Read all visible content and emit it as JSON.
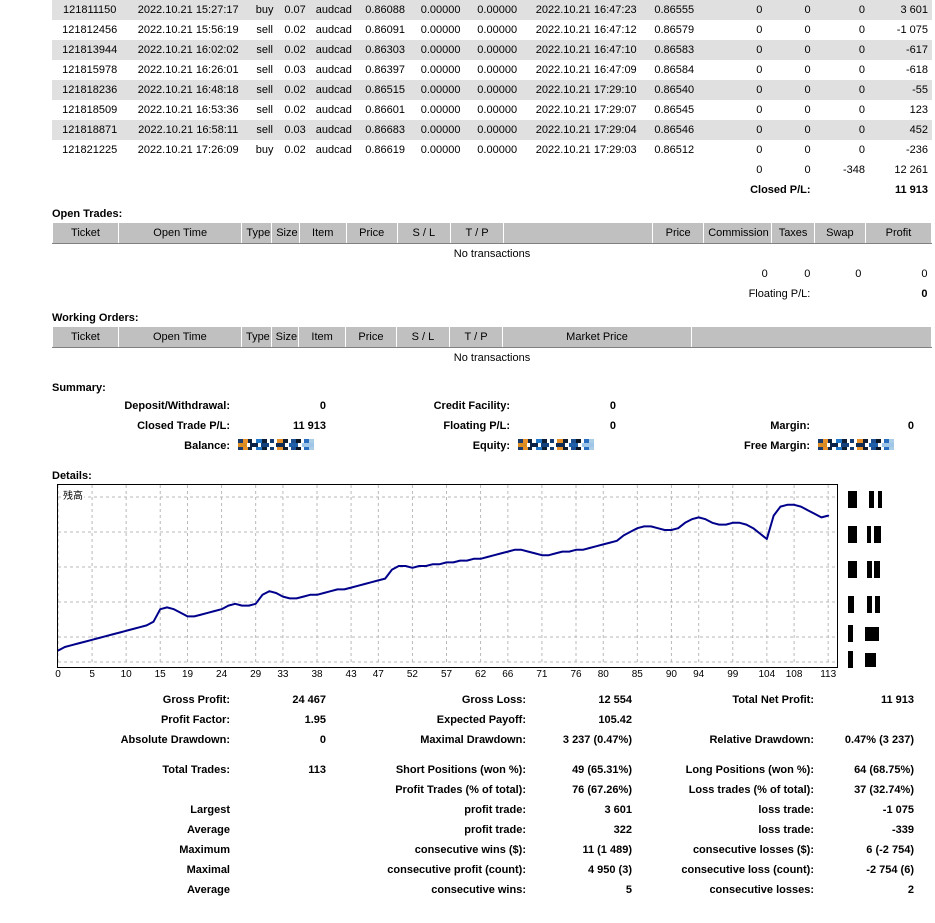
{
  "closed_deals": {
    "rows": [
      {
        "ticket": "121811150",
        "open_time": "2022.10.21 15:27:17",
        "type": "buy",
        "size": "0.07",
        "item": "audcad",
        "price": "0.86088",
        "sl": "0.00000",
        "tp": "0.00000",
        "close_time": "2022.10.21 16:47:23",
        "close_price": "0.86555",
        "commission": "0",
        "taxes": "0",
        "swap": "0",
        "profit": "3 601"
      },
      {
        "ticket": "121812456",
        "open_time": "2022.10.21 15:56:19",
        "type": "sell",
        "size": "0.02",
        "item": "audcad",
        "price": "0.86091",
        "sl": "0.00000",
        "tp": "0.00000",
        "close_time": "2022.10.21 16:47:12",
        "close_price": "0.86579",
        "commission": "0",
        "taxes": "0",
        "swap": "0",
        "profit": "-1 075"
      },
      {
        "ticket": "121813944",
        "open_time": "2022.10.21 16:02:02",
        "type": "sell",
        "size": "0.02",
        "item": "audcad",
        "price": "0.86303",
        "sl": "0.00000",
        "tp": "0.00000",
        "close_time": "2022.10.21 16:47:10",
        "close_price": "0.86583",
        "commission": "0",
        "taxes": "0",
        "swap": "0",
        "profit": "-617"
      },
      {
        "ticket": "121815978",
        "open_time": "2022.10.21 16:26:01",
        "type": "sell",
        "size": "0.03",
        "item": "audcad",
        "price": "0.86397",
        "sl": "0.00000",
        "tp": "0.00000",
        "close_time": "2022.10.21 16:47:09",
        "close_price": "0.86584",
        "commission": "0",
        "taxes": "0",
        "swap": "0",
        "profit": "-618"
      },
      {
        "ticket": "121818236",
        "open_time": "2022.10.21 16:48:18",
        "type": "sell",
        "size": "0.02",
        "item": "audcad",
        "price": "0.86515",
        "sl": "0.00000",
        "tp": "0.00000",
        "close_time": "2022.10.21 17:29:10",
        "close_price": "0.86540",
        "commission": "0",
        "taxes": "0",
        "swap": "0",
        "profit": "-55"
      },
      {
        "ticket": "121818509",
        "open_time": "2022.10.21 16:53:36",
        "type": "sell",
        "size": "0.02",
        "item": "audcad",
        "price": "0.86601",
        "sl": "0.00000",
        "tp": "0.00000",
        "close_time": "2022.10.21 17:29:07",
        "close_price": "0.86545",
        "commission": "0",
        "taxes": "0",
        "swap": "0",
        "profit": "123"
      },
      {
        "ticket": "121818871",
        "open_time": "2022.10.21 16:58:11",
        "type": "sell",
        "size": "0.03",
        "item": "audcad",
        "price": "0.86683",
        "sl": "0.00000",
        "tp": "0.00000",
        "close_time": "2022.10.21 17:29:04",
        "close_price": "0.86546",
        "commission": "0",
        "taxes": "0",
        "swap": "0",
        "profit": "452"
      },
      {
        "ticket": "121821225",
        "open_time": "2022.10.21 17:26:09",
        "type": "buy",
        "size": "0.02",
        "item": "audcad",
        "price": "0.86619",
        "sl": "0.00000",
        "tp": "0.00000",
        "close_time": "2022.10.21 17:29:03",
        "close_price": "0.86512",
        "commission": "0",
        "taxes": "0",
        "swap": "0",
        "profit": "-236"
      }
    ],
    "totals": {
      "commission": "0",
      "taxes": "0",
      "swap": "-348",
      "profit": "12 261"
    },
    "closed_pl_label": "Closed P/L:",
    "closed_pl_value": "11 913"
  },
  "open_trades": {
    "caption": "Open Trades:",
    "headers": [
      "Ticket",
      "Open Time",
      "Type",
      "Size",
      "Item",
      "Price",
      "S / L",
      "T / P",
      "",
      "Price",
      "Commission",
      "Taxes",
      "Swap",
      "Profit"
    ],
    "empty_text": "No transactions",
    "totals": {
      "commission": "0",
      "taxes": "0",
      "swap": "0",
      "profit": "0"
    },
    "floating_pl_label": "Floating P/L:",
    "floating_pl_value": "0"
  },
  "working_orders": {
    "caption": "Working Orders:",
    "headers": [
      "Ticket",
      "Open Time",
      "Type",
      "Size",
      "Item",
      "Price",
      "S / L",
      "T / P",
      "Market Price",
      ""
    ],
    "empty_text": "No transactions"
  },
  "summary": {
    "caption": "Summary:",
    "rows": [
      {
        "k1": "Deposit/Withdrawal:",
        "v1": "0",
        "k2": "Credit Facility:",
        "v2": "0",
        "k3": "",
        "v3": ""
      },
      {
        "k1": "Closed Trade P/L:",
        "v1": "11 913",
        "k2": "Floating P/L:",
        "v2": "0",
        "k3": "Margin:",
        "v3": "0"
      },
      {
        "k1": "Balance:",
        "v1": "[redacted]",
        "k2": "Equity:",
        "v2": "[redacted]",
        "k3": "Free Margin:",
        "v3": "[redacted]"
      }
    ]
  },
  "details": {
    "caption": "Details:"
  },
  "chart_data": {
    "type": "line",
    "title": "残高",
    "xlabel": "",
    "ylabel": "",
    "grid": true,
    "legend": false,
    "y_tick_labels_redacted": true,
    "series_color": "#00008B",
    "x_tick_labels": [
      "0",
      "5",
      "10",
      "15",
      "19",
      "24",
      "29",
      "33",
      "38",
      "43",
      "47",
      "52",
      "57",
      "62",
      "66",
      "71",
      "76",
      "80",
      "85",
      "90",
      "94",
      "99",
      "104",
      "108",
      "113"
    ],
    "xlim": [
      0,
      114
    ],
    "ylim": [
      0,
      100
    ],
    "x": [
      0,
      1,
      2,
      3,
      4,
      5,
      6,
      7,
      8,
      9,
      10,
      11,
      12,
      13,
      14,
      15,
      16,
      17,
      18,
      19,
      20,
      21,
      22,
      23,
      24,
      25,
      26,
      27,
      28,
      29,
      30,
      31,
      32,
      33,
      34,
      35,
      36,
      37,
      38,
      39,
      40,
      41,
      42,
      43,
      44,
      45,
      46,
      47,
      48,
      49,
      50,
      51,
      52,
      53,
      54,
      55,
      56,
      57,
      58,
      59,
      60,
      61,
      62,
      63,
      64,
      65,
      66,
      67,
      68,
      69,
      70,
      71,
      72,
      73,
      74,
      75,
      76,
      77,
      78,
      79,
      80,
      81,
      82,
      83,
      84,
      85,
      86,
      87,
      88,
      89,
      90,
      91,
      92,
      93,
      94,
      95,
      96,
      97,
      98,
      99,
      100,
      101,
      102,
      103,
      104,
      105,
      106,
      107,
      108,
      109,
      110,
      111,
      112,
      113
    ],
    "y": [
      8,
      10,
      11,
      12,
      13,
      14,
      15,
      16,
      17,
      18,
      19,
      20,
      21,
      22,
      24,
      31,
      32,
      31,
      29,
      27,
      27,
      28,
      29,
      30,
      31,
      33,
      34,
      33,
      33,
      34,
      39,
      41,
      40,
      38,
      37,
      37,
      38,
      39,
      39,
      40,
      41,
      42,
      42,
      43,
      44,
      45,
      46,
      47,
      48,
      53,
      55,
      55,
      54,
      55,
      55,
      56,
      56,
      57,
      57,
      58,
      58,
      59,
      59,
      60,
      61,
      62,
      63,
      64,
      64,
      63,
      62,
      61,
      61,
      62,
      63,
      63,
      64,
      64,
      65,
      66,
      67,
      68,
      69,
      72,
      74,
      76,
      77,
      77,
      76,
      75,
      75,
      76,
      79,
      81,
      82,
      81,
      79,
      78,
      78,
      79,
      79,
      78,
      76,
      73,
      70,
      83,
      88,
      89,
      89,
      88,
      86,
      84,
      82,
      83
    ],
    "note": "Equity/balance growth curve; y-axis tick values are redacted (black blocks) in the source image so values are expressed on a relative 0-100 scale."
  },
  "stats": {
    "rows": [
      {
        "k1": "Gross Profit:",
        "v1": "24 467",
        "k2": "Gross Loss:",
        "v2": "12 554",
        "k3": "Total Net Profit:",
        "v3": "11 913"
      },
      {
        "k1": "Profit Factor:",
        "v1": "1.95",
        "k2": "Expected Payoff:",
        "v2": "105.42",
        "k3": "",
        "v3": ""
      },
      {
        "k1": "Absolute Drawdown:",
        "v1": "0",
        "k2": "Maximal Drawdown:",
        "v2": "3 237 (0.47%)",
        "k3": "Relative Drawdown:",
        "v3": "0.47% (3 237)"
      }
    ],
    "rows2": [
      {
        "k1": "Total Trades:",
        "v1": "113",
        "k2": "Short Positions (won %):",
        "v2": "49 (65.31%)",
        "k3": "Long Positions (won %):",
        "v3": "64 (68.75%)"
      },
      {
        "k1": "",
        "v1": "",
        "k2": "Profit Trades (% of total):",
        "v2": "76 (67.26%)",
        "k3": "Loss trades (% of total):",
        "v3": "37 (32.74%)"
      },
      {
        "k1": "Largest",
        "v1": "",
        "k2": "profit trade:",
        "v2": "3 601",
        "k3": "loss trade:",
        "v3": "-1 075"
      },
      {
        "k1": "Average",
        "v1": "",
        "k2": "profit trade:",
        "v2": "322",
        "k3": "loss trade:",
        "v3": "-339"
      },
      {
        "k1": "Maximum",
        "v1": "",
        "k2": "consecutive wins ($):",
        "v2": "11 (1 489)",
        "k3": "consecutive losses ($):",
        "v3": "6 (-2 754)"
      },
      {
        "k1": "Maximal",
        "v1": "",
        "k2": "consecutive profit (count):",
        "v2": "4 950 (3)",
        "k3": "consecutive loss (count):",
        "v3": "-2 754 (6)"
      },
      {
        "k1": "Average",
        "v1": "",
        "k2": "consecutive wins:",
        "v2": "5",
        "k3": "consecutive losses:",
        "v3": "2"
      }
    ]
  }
}
